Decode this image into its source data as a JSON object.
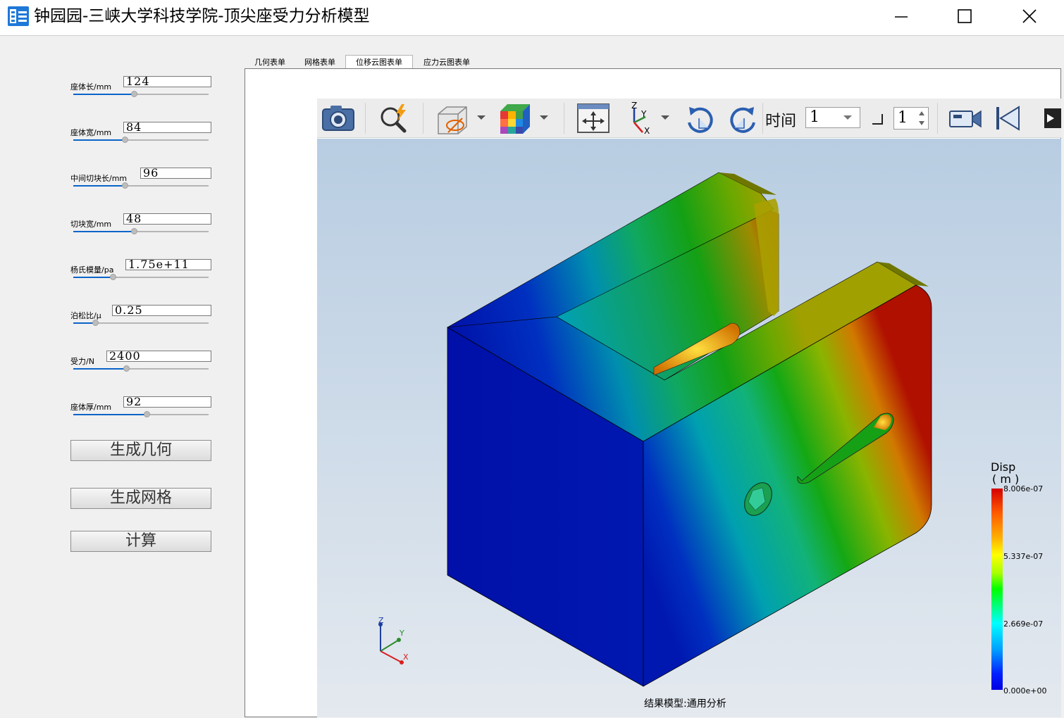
{
  "window": {
    "title": "钟园园-三峡大学科技学院-顶尖座受力分析模型",
    "controls": [
      "minimize",
      "maximize",
      "close"
    ]
  },
  "params": [
    {
      "label": "座体长/mm",
      "value": "124",
      "slider_fraction": 0.45
    },
    {
      "label": "座体宽/mm",
      "value": "84",
      "slider_fraction": 0.38
    },
    {
      "label": "中间切块长/mm",
      "value": "96",
      "slider_fraction": 0.38
    },
    {
      "label": "切块宽/mm",
      "value": "48",
      "slider_fraction": 0.45
    },
    {
      "label": "杨氏模量/pa",
      "value": "1.75e+11",
      "slider_fraction": 0.29
    },
    {
      "label": "泊松比/μ",
      "value": "0.25",
      "slider_fraction": 0.16
    },
    {
      "label": "受力/N",
      "value": "2400",
      "slider_fraction": 0.39
    },
    {
      "label": "座体厚/mm",
      "value": "92",
      "slider_fraction": 0.54
    }
  ],
  "buttons": {
    "generate_geometry": "生成几何",
    "generate_mesh": "生成网格",
    "compute": "计算"
  },
  "tabs": [
    {
      "label": "几何表单",
      "active": false
    },
    {
      "label": "网格表单",
      "active": false
    },
    {
      "label": "位移云图表单",
      "active": true
    },
    {
      "label": "应力云图表单",
      "active": false
    }
  ],
  "toolbar": {
    "icons": [
      "camera-icon",
      "quick-zoom-icon",
      "visibility-box-icon",
      "color-cube-icon",
      "fit-view-icon",
      "axes-icon",
      "rotate-cw-icon",
      "rotate-ccw-icon",
      "video-camera-icon",
      "first-frame-icon",
      "next-icon"
    ],
    "time_label": "时间",
    "time_value": "1",
    "step_value": "1"
  },
  "viewport": {
    "caption": "结果模型:通用分析",
    "triad_labels": {
      "z": "Z",
      "y": "Y",
      "x": "X"
    }
  },
  "legend": {
    "title": "Disp",
    "unit": "( m )",
    "ticks": [
      "8.006e-07",
      "5.337e-07",
      "2.669e-07",
      "0.000e+00"
    ],
    "color_top": "#d40000",
    "color_bottom": "#0000e0"
  },
  "colors": {
    "accent": "#0a64c8",
    "app_icon": "#1e78d8"
  }
}
